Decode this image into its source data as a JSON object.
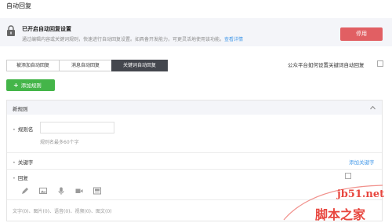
{
  "page": {
    "title": "自动回复"
  },
  "notice": {
    "title": "已开启自动回复设置",
    "desc": "通过编辑内容或关键词规则，快速进行自动回复设置。如具备开发能力，可更灵活地使用该功能。",
    "link": "查看详情",
    "disable_label": "停用"
  },
  "tabs": [
    {
      "label": "被添加自动回复"
    },
    {
      "label": "消息自动回复"
    },
    {
      "label": "关键词自动回复"
    }
  ],
  "setting_link": "公众平台如何设置关键词自动回复",
  "add_rule_label": "添加规则",
  "rule": {
    "header": "新规则",
    "name_label": "规则名",
    "name_hint": "规则名最多60个字",
    "keyword_label": "关键字",
    "add_keyword": "添加关键字",
    "reply_label": "回复",
    "counts": "文字(0)、图片(0)、语音(0)、视频(0)、图文(0)"
  },
  "watermark": {
    "domain": "jb51.net",
    "name": "脚本之家"
  },
  "colors": {
    "accent_green": "#44b549",
    "danger_red": "#e15f63",
    "link_blue": "#459ae9",
    "tab_active": "#44474e"
  },
  "icons": [
    "lock-icon",
    "collapse-icon",
    "edit-icon",
    "image-icon",
    "microphone-icon",
    "video-icon",
    "news-icon"
  ]
}
